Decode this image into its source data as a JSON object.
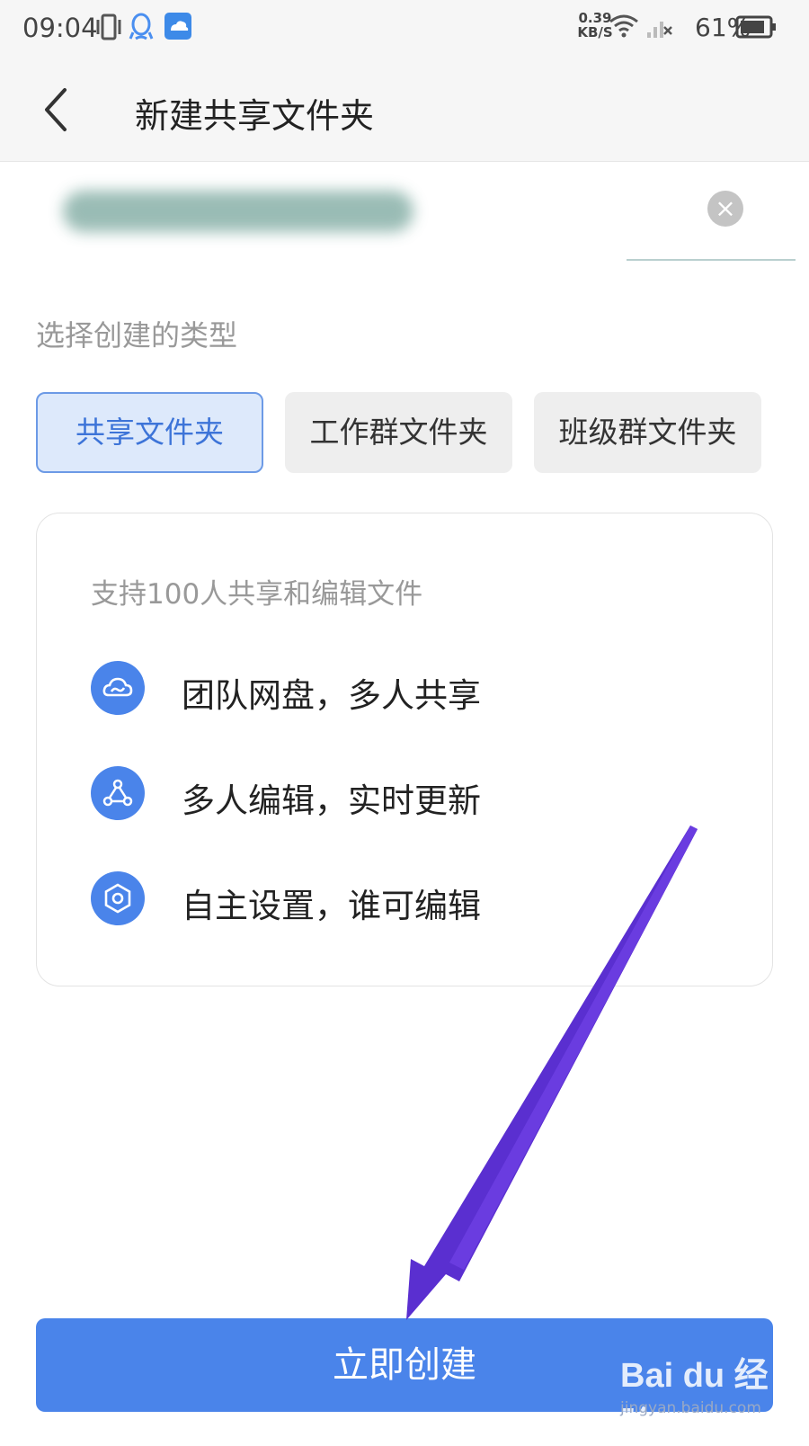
{
  "status_bar": {
    "time": "09:04",
    "net_speed_value": "0.39",
    "net_speed_unit": "KB/S",
    "battery": "61%"
  },
  "header": {
    "title": "新建共享文件夹"
  },
  "form": {
    "type_label": "选择创建的类型",
    "types": [
      {
        "label": "共享文件夹",
        "selected": true
      },
      {
        "label": "工作群文件夹",
        "selected": false
      },
      {
        "label": "班级群文件夹",
        "selected": false
      }
    ]
  },
  "card": {
    "title": "支持100人共享和编辑文件",
    "features": [
      {
        "icon": "cloud-icon",
        "text": "团队网盘，多人共享"
      },
      {
        "icon": "network-icon",
        "text": "多人编辑，实时更新"
      },
      {
        "icon": "settings-hexagon-icon",
        "text": "自主设置，谁可编辑"
      }
    ]
  },
  "create_button": {
    "label": "立即创建"
  },
  "watermark": {
    "logo": "Bai du 经验",
    "url": "jingyan.baidu.com"
  },
  "colors": {
    "accent": "#4a84ea",
    "selected_bg": "#dde9fb",
    "annotation_arrow": "#5a2fd0"
  }
}
